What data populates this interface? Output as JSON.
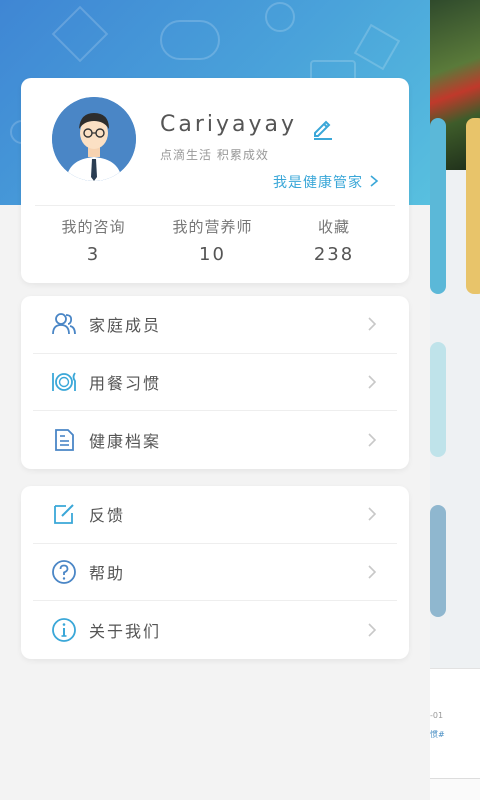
{
  "profile": {
    "username": "Cariyayay",
    "motto": "点滴生活 积累成效",
    "manager_link": "我是健康管家"
  },
  "stats": [
    {
      "label": "我的咨询",
      "value": "3"
    },
    {
      "label": "我的营养师",
      "value": "10"
    },
    {
      "label": "收藏",
      "value": "238"
    }
  ],
  "menu_group_1": [
    {
      "label": "家庭成员",
      "icon": "family-icon"
    },
    {
      "label": "用餐习惯",
      "icon": "dining-icon"
    },
    {
      "label": "健康档案",
      "icon": "health-record-icon"
    }
  ],
  "menu_group_2": [
    {
      "label": "反馈",
      "icon": "feedback-icon"
    },
    {
      "label": "帮助",
      "icon": "help-icon"
    },
    {
      "label": "关于我们",
      "icon": "info-icon"
    }
  ],
  "background": {
    "snippet_date": "-01",
    "snippet_tag": "惯#"
  },
  "colors": {
    "header_start": "#3f86d4",
    "header_end": "#58c0df",
    "accent": "#3aa7d8",
    "icon_blue": "#4a86c6"
  }
}
